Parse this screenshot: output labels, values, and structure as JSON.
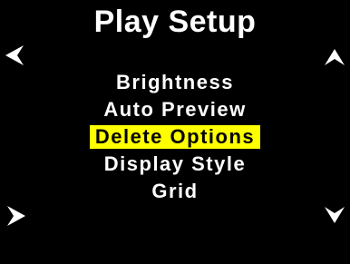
{
  "screen": {
    "title": "Play Setup"
  },
  "menu": {
    "items": [
      {
        "label": "Brightness",
        "selected": false
      },
      {
        "label": "Auto Preview",
        "selected": false
      },
      {
        "label": "Delete Options",
        "selected": true
      },
      {
        "label": "Display Style",
        "selected": false
      },
      {
        "label": "Grid",
        "selected": false
      }
    ]
  },
  "navigation": {
    "left_icon": "arrow-left-icon",
    "right_icon": "arrow-right-icon",
    "up_icon": "arrow-up-icon",
    "down_icon": "arrow-down-icon"
  },
  "colors": {
    "background": "#000000",
    "text": "#ffffff",
    "highlight": "#ffff00",
    "highlight_text": "#000000"
  }
}
